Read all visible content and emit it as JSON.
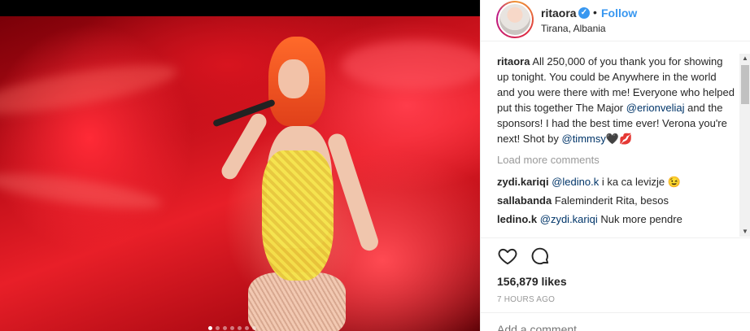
{
  "post": {
    "username": "ritaora",
    "verified_glyph": "✓",
    "separator": "•",
    "follow_label": "Follow",
    "location": "Tirana, Albania",
    "image_dots": {
      "count": 7,
      "active_index": 0
    }
  },
  "caption": {
    "user": "ritaora",
    "text_1": " All 250,000 of you thank you for showing up tonight. You could be Anywhere in the world and you were there with me! Everyone who helped put this together The Major ",
    "mention_1": "@erionveliaj",
    "text_2": " and the sponsors! I had the best time ever! Verona you're next! Shot by ",
    "mention_2": "@timmsy",
    "text_3": "🖤💋"
  },
  "load_more_label": "Load more comments",
  "comments": [
    {
      "user": "zydi.kariqi",
      "mention": "@ledino.k",
      "text": " i ka ca levizje 😉"
    },
    {
      "user": "sallabanda",
      "mention": "",
      "text": " Faleminderit Rita, besos"
    },
    {
      "user": "ledino.k",
      "mention": "@zydi.kariqi",
      "text": " Nuk more pendre"
    }
  ],
  "actions": {
    "heart_icon": "heart-icon",
    "comment_icon": "comment-icon"
  },
  "likes_text": "156,879 likes",
  "timestamp": "7 HOURS AGO",
  "add_comment_placeholder": "Add a comment...",
  "colors": {
    "accent": "#3897f0",
    "mention": "#003569",
    "muted": "#999999",
    "text": "#262626"
  }
}
